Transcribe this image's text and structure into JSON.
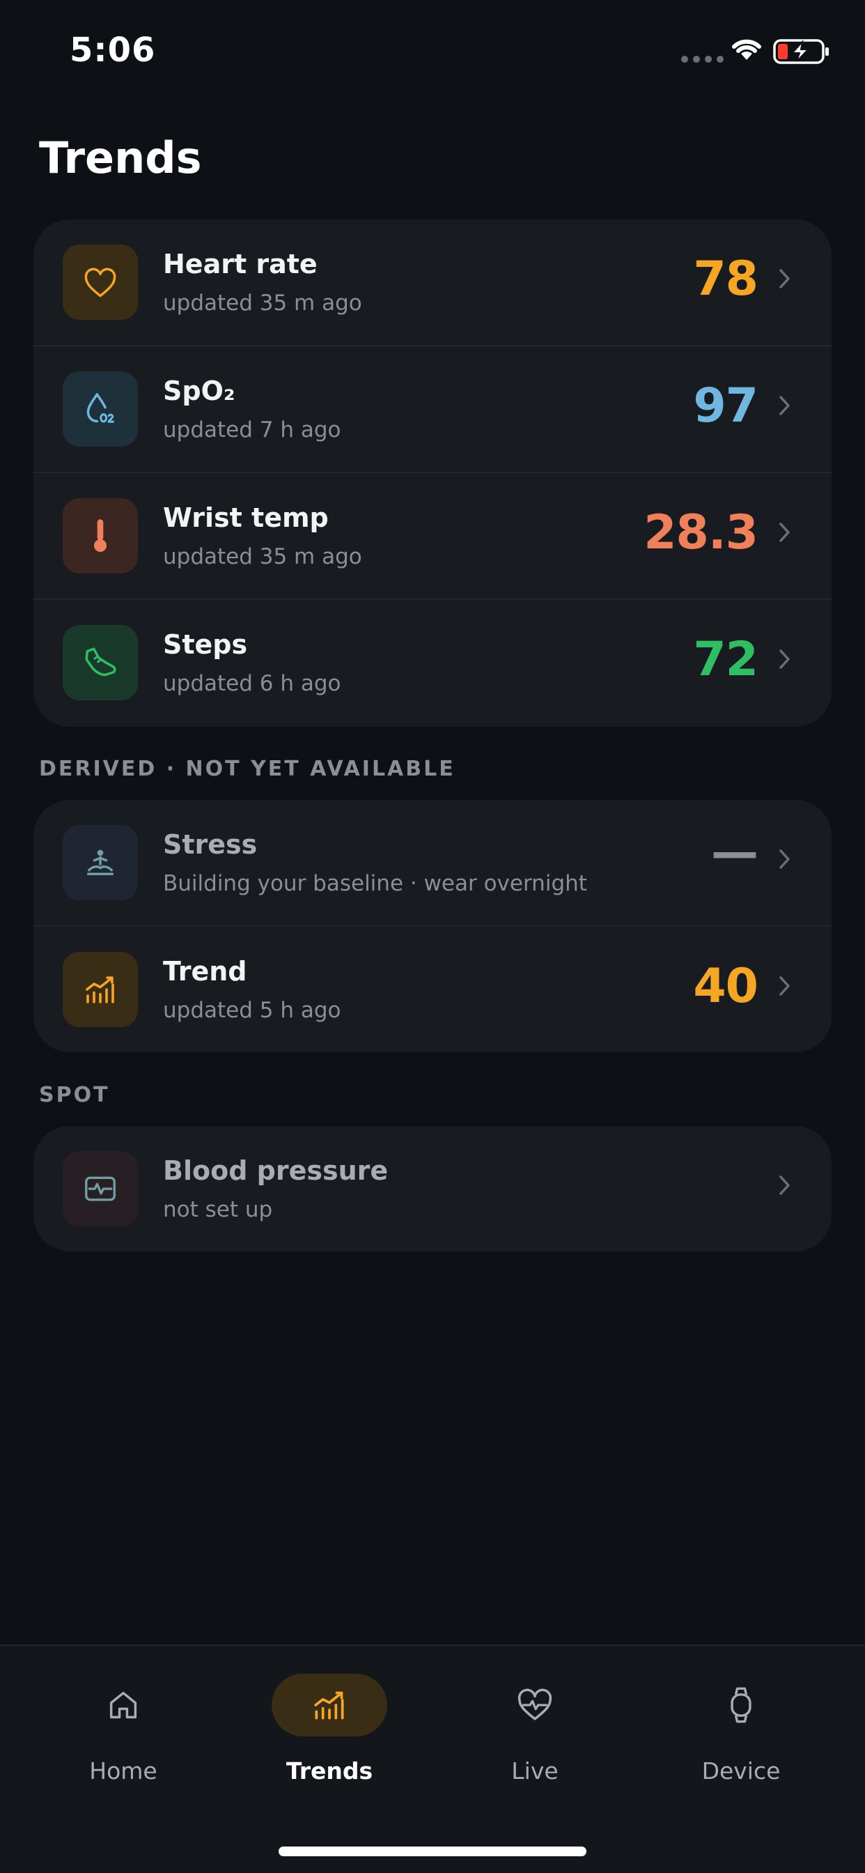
{
  "status_bar": {
    "time": "5:06"
  },
  "page": {
    "title": "Trends"
  },
  "metrics": [
    {
      "title": "Heart rate",
      "subtitle": "updated 35 m ago",
      "value": "78",
      "icon": "heart-icon",
      "color": "#f5a623"
    },
    {
      "title": "SpO₂",
      "subtitle": "updated 7 h ago",
      "value": "97",
      "icon": "water-drop-o2-icon",
      "color": "#6fb7e0"
    },
    {
      "title": "Wrist temp",
      "subtitle": "updated 35 m ago",
      "value": "28.3",
      "icon": "thermometer-icon",
      "color": "#f0805a"
    },
    {
      "title": "Steps",
      "subtitle": "updated 6 h ago",
      "value": "72",
      "icon": "sneaker-icon",
      "color": "#2fbf63"
    }
  ],
  "derived": {
    "label": "DERIVED · NOT YET AVAILABLE",
    "items": [
      {
        "title": "Stress",
        "subtitle": "Building your baseline · wear overnight",
        "value": "—",
        "icon": "meditation-icon",
        "color": "#8a8f96"
      },
      {
        "title": "Trend",
        "subtitle": "updated 5 h ago",
        "value": "40",
        "icon": "trend-chart-icon",
        "color": "#f5a623"
      }
    ]
  },
  "spot": {
    "label": "SPOT",
    "items": [
      {
        "title": "Blood pressure",
        "subtitle": "not set up",
        "icon": "blood-pressure-icon"
      }
    ]
  },
  "nav": [
    {
      "label": "Home",
      "icon": "home-icon",
      "active": false
    },
    {
      "label": "Trends",
      "icon": "trend-chart-icon",
      "active": true
    },
    {
      "label": "Live",
      "icon": "heart-pulse-icon",
      "active": false
    },
    {
      "label": "Device",
      "icon": "watch-icon",
      "active": false
    }
  ],
  "colors": {
    "background": "#0d1014",
    "card": "#181c21",
    "accent": "#f5a623"
  }
}
